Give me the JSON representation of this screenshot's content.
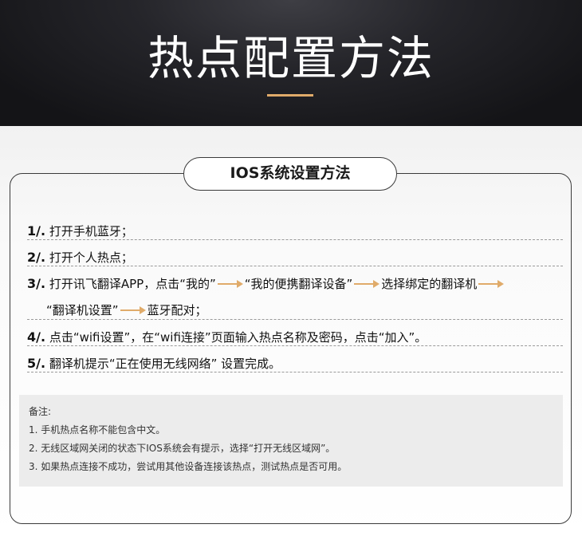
{
  "header": {
    "title": "热点配置方法"
  },
  "section": {
    "title": "IOS系统设置方法"
  },
  "steps": [
    {
      "num": "1/.",
      "text": "打开手机蓝牙；"
    },
    {
      "num": "2/.",
      "text": "打开个人热点；"
    },
    {
      "num": "3/.",
      "part1": "打开讯飞翻译APP，点击“我的”",
      "part2": "“我的便携翻译设备”",
      "part3": "选择绑定的翻译机",
      "part4": "“翻译机设置”",
      "part5": "蓝牙配对；"
    },
    {
      "num": "4/.",
      "text": "点击“wifi设置”，在“wifi连接”页面输入热点名称及密码，点击“加入”。"
    },
    {
      "num": "5/.",
      "text": "翻译机提示“正在使用无线网络” 设置完成。"
    }
  ],
  "notes": {
    "title": "备注:",
    "items": [
      "1. 手机热点名称不能包含中文。",
      "2. 无线区域网关闭的状态下IOS系统会有提示，选择“打开无线区域网”。",
      "3. 如果热点连接不成功，尝试用其他设备连接该热点，测试热点是否可用。"
    ]
  },
  "colors": {
    "accent": "#e0ab6a",
    "header_bg": "#1c1c20",
    "frame": "#3a3a3a",
    "notes_bg": "#ececec"
  },
  "icons": {
    "flow_arrow": "arrow-right-icon"
  }
}
